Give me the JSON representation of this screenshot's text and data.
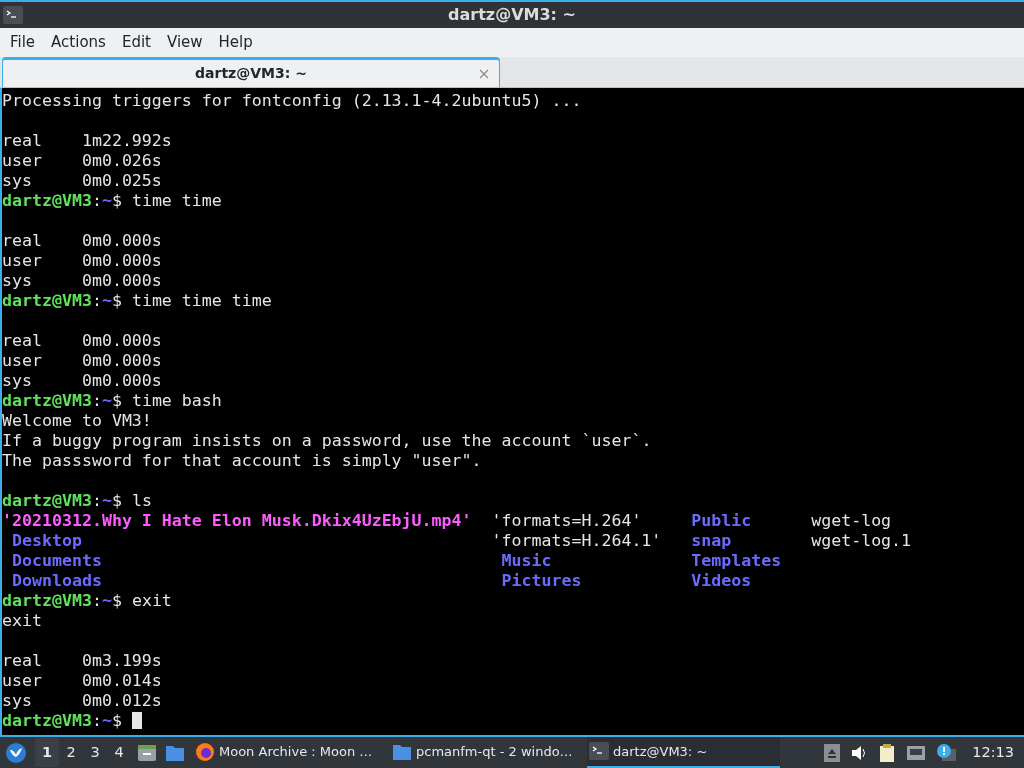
{
  "window": {
    "title": "dartz@VM3: ~"
  },
  "menu": [
    "File",
    "Actions",
    "Edit",
    "View",
    "Help"
  ],
  "tabs": [
    {
      "label": "dartz@VM3: ~",
      "selected": true
    }
  ],
  "terminal": {
    "lines": [
      {
        "segments": [
          {
            "kind": "plain",
            "text": "Processing triggers for fontconfig (2.13.1-4.2ubuntu5) ..."
          }
        ]
      },
      {
        "blank_before": true,
        "segments": [
          {
            "kind": "plain",
            "text": "real    1m22.992s"
          }
        ]
      },
      {
        "segments": [
          {
            "kind": "plain",
            "text": "user    0m0.026s"
          }
        ]
      },
      {
        "segments": [
          {
            "kind": "plain",
            "text": "sys     0m0.025s"
          }
        ]
      },
      {
        "segments": [
          {
            "kind": "user",
            "text": "dartz@VM3"
          },
          {
            "kind": "plain",
            "text": ":"
          },
          {
            "kind": "path",
            "text": "~"
          },
          {
            "kind": "plain",
            "text": "$ time time"
          }
        ]
      },
      {
        "blank_before": true,
        "segments": [
          {
            "kind": "plain",
            "text": "real    0m0.000s"
          }
        ]
      },
      {
        "segments": [
          {
            "kind": "plain",
            "text": "user    0m0.000s"
          }
        ]
      },
      {
        "segments": [
          {
            "kind": "plain",
            "text": "sys     0m0.000s"
          }
        ]
      },
      {
        "segments": [
          {
            "kind": "user",
            "text": "dartz@VM3"
          },
          {
            "kind": "plain",
            "text": ":"
          },
          {
            "kind": "path",
            "text": "~"
          },
          {
            "kind": "plain",
            "text": "$ time time time"
          }
        ]
      },
      {
        "blank_before": true,
        "segments": [
          {
            "kind": "plain",
            "text": "real    0m0.000s"
          }
        ]
      },
      {
        "segments": [
          {
            "kind": "plain",
            "text": "user    0m0.000s"
          }
        ]
      },
      {
        "segments": [
          {
            "kind": "plain",
            "text": "sys     0m0.000s"
          }
        ]
      },
      {
        "segments": [
          {
            "kind": "user",
            "text": "dartz@VM3"
          },
          {
            "kind": "plain",
            "text": ":"
          },
          {
            "kind": "path",
            "text": "~"
          },
          {
            "kind": "plain",
            "text": "$ time bash"
          }
        ]
      },
      {
        "segments": [
          {
            "kind": "plain",
            "text": "Welcome to VM3!"
          }
        ]
      },
      {
        "segments": [
          {
            "kind": "plain",
            "text": "If a buggy program insists on a password, use the account `user`."
          }
        ]
      },
      {
        "segments": [
          {
            "kind": "plain",
            "text": "The passsword for that account is simply \"user\"."
          }
        ]
      },
      {
        "blank_before": true,
        "segments": [
          {
            "kind": "user",
            "text": "dartz@VM3"
          },
          {
            "kind": "plain",
            "text": ":"
          },
          {
            "kind": "path",
            "text": "~"
          },
          {
            "kind": "plain",
            "text": "$ ls"
          }
        ]
      },
      {
        "ls": [
          [
            {
              "kind": "media",
              "text": "'20210312.Why I Hate Elon Musk.Dkix4UzEbjU.mp4'"
            },
            {
              "kind": "plain",
              "text": "'formats=H.264'"
            },
            {
              "kind": "dir",
              "text": "Public"
            },
            {
              "kind": "plain",
              "text": "wget-log"
            }
          ],
          [
            {
              "kind": "dir",
              "text": " Desktop"
            },
            {
              "kind": "plain",
              "text": "'formats=H.264.1'"
            },
            {
              "kind": "dir",
              "text": "snap"
            },
            {
              "kind": "plain",
              "text": "wget-log.1"
            }
          ],
          [
            {
              "kind": "dir",
              "text": " Documents"
            },
            {
              "kind": "dir",
              "text": " Music"
            },
            {
              "kind": "dir",
              "text": "Templates"
            }
          ],
          [
            {
              "kind": "dir",
              "text": " Downloads"
            },
            {
              "kind": "dir",
              "text": " Pictures"
            },
            {
              "kind": "dir",
              "text": "Videos"
            }
          ]
        ]
      },
      {
        "segments": [
          {
            "kind": "user",
            "text": "dartz@VM3"
          },
          {
            "kind": "plain",
            "text": ":"
          },
          {
            "kind": "path",
            "text": "~"
          },
          {
            "kind": "plain",
            "text": "$ exit"
          }
        ]
      },
      {
        "segments": [
          {
            "kind": "plain",
            "text": "exit"
          }
        ]
      },
      {
        "blank_before": true,
        "segments": [
          {
            "kind": "plain",
            "text": "real    0m3.199s"
          }
        ]
      },
      {
        "segments": [
          {
            "kind": "plain",
            "text": "user    0m0.014s"
          }
        ]
      },
      {
        "segments": [
          {
            "kind": "plain",
            "text": "sys     0m0.012s"
          }
        ]
      },
      {
        "segments": [
          {
            "kind": "user",
            "text": "dartz@VM3"
          },
          {
            "kind": "plain",
            "text": ":"
          },
          {
            "kind": "path",
            "text": "~"
          },
          {
            "kind": "plain",
            "text": "$ "
          },
          {
            "kind": "cursor"
          }
        ]
      }
    ]
  },
  "taskbar": {
    "desktops": [
      {
        "label": "1",
        "selected": true
      },
      {
        "label": "2",
        "selected": false
      },
      {
        "label": "3",
        "selected": false
      },
      {
        "label": "4",
        "selected": false
      }
    ],
    "tasks": [
      {
        "kind": "browser",
        "label": "Moon Archive : Moon …",
        "selected": false
      },
      {
        "kind": "folder",
        "label": "pcmanfm-qt - 2 windo…",
        "selected": false
      },
      {
        "kind": "terminal",
        "label": "dartz@VM3: ~",
        "selected": true
      }
    ],
    "clock": "12:13"
  }
}
